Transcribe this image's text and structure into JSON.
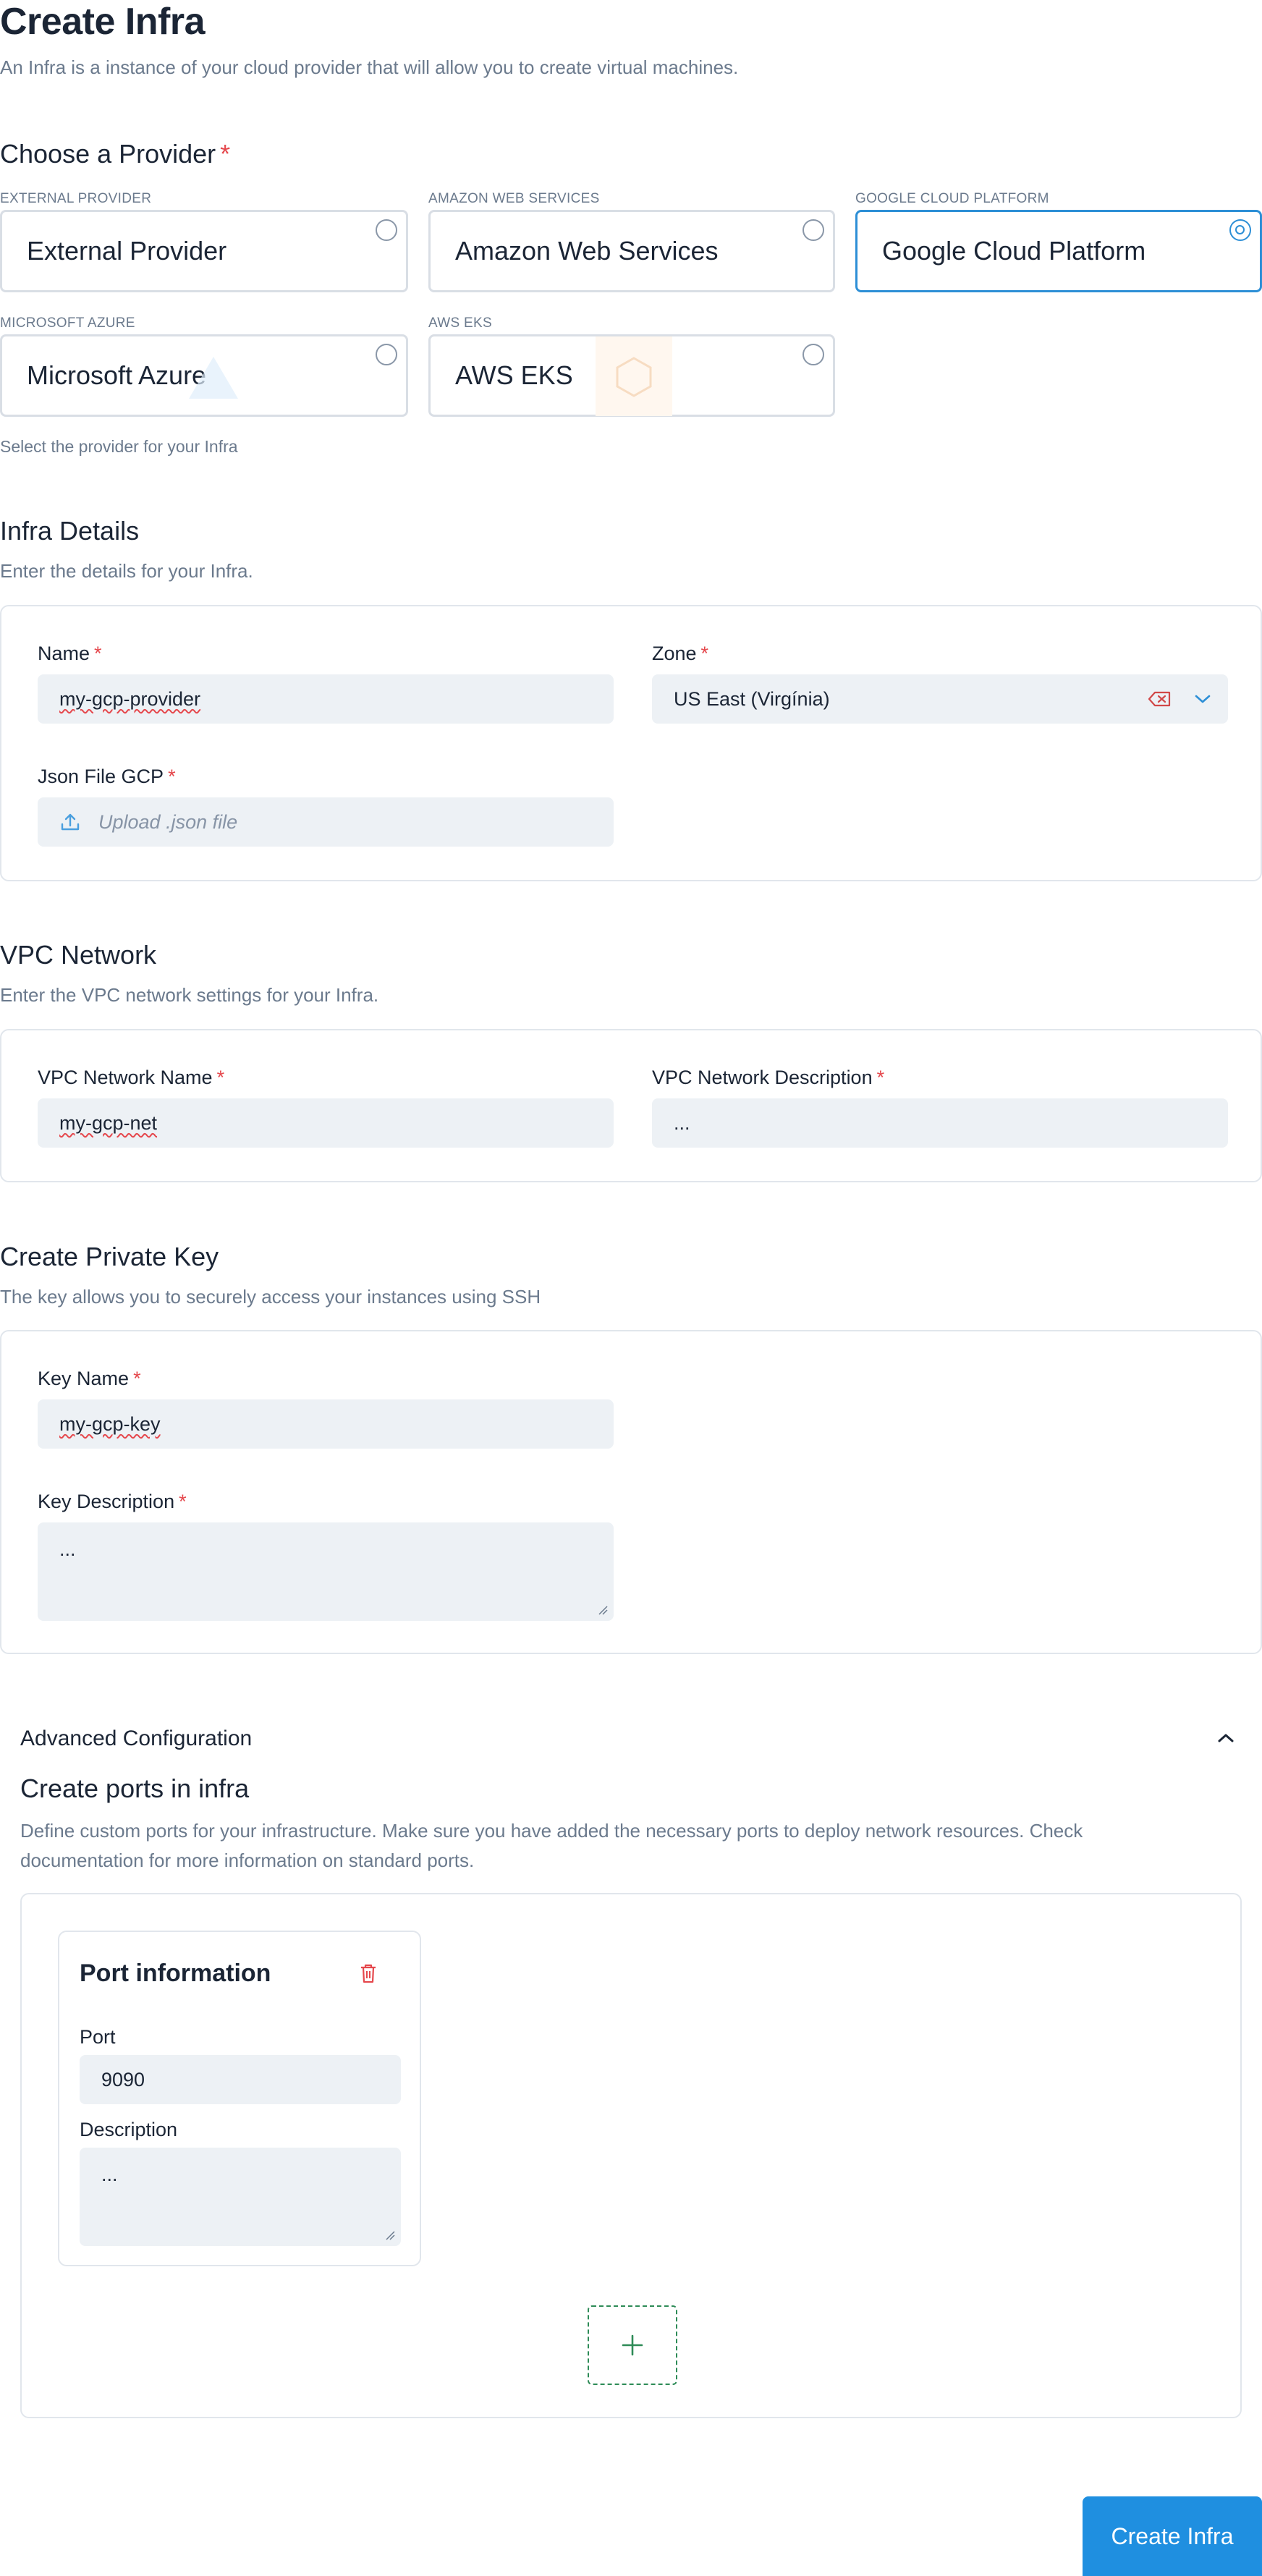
{
  "page": {
    "title": "Create Infra",
    "subtitle": "An Infra is a instance of your cloud provider that will allow you to create virtual machines."
  },
  "provider": {
    "heading": "Choose a Provider",
    "required": "*",
    "helper": "Select the provider for your Infra",
    "options": [
      {
        "caption": "EXTERNAL PROVIDER",
        "label": "External Provider",
        "selected": false
      },
      {
        "caption": "AMAZON WEB SERVICES",
        "label": "Amazon Web Services",
        "selected": false
      },
      {
        "caption": "GOOGLE CLOUD PLATFORM",
        "label": "Google Cloud Platform",
        "selected": true
      },
      {
        "caption": "MICROSOFT AZURE",
        "label": "Microsoft Azure",
        "selected": false
      },
      {
        "caption": "AWS EKS",
        "label": "AWS EKS",
        "selected": false
      }
    ]
  },
  "details": {
    "heading": "Infra Details",
    "subtitle": "Enter the details for your Infra.",
    "name_label": "Name",
    "name_value": "my-gcp-provider",
    "zone_label": "Zone",
    "zone_value": "US East (Virgínia)",
    "json_label": "Json File GCP",
    "json_placeholder": "Upload .json file",
    "required": "*"
  },
  "vpc": {
    "heading": "VPC Network",
    "subtitle": "Enter the VPC network settings for your Infra.",
    "name_label": "VPC Network Name",
    "name_value": "my-gcp-net",
    "desc_label": "VPC Network Description",
    "desc_value": "...",
    "required": "*"
  },
  "key": {
    "heading": "Create Private Key",
    "subtitle": "The key allows you to securely access your instances using SSH",
    "name_label": "Key Name",
    "name_value": "my-gcp-key",
    "desc_label": "Key Description",
    "desc_value": "...",
    "required": "*"
  },
  "advanced": {
    "toggle_label": "Advanced Configuration",
    "ports_heading": "Create ports in infra",
    "ports_description": "Define custom ports for your infrastructure. Make sure you have added the necessary ports to deploy network resources. Check documentation for more information on standard ports.",
    "port_card": {
      "title": "Port information",
      "port_label": "Port",
      "port_value": "9090",
      "desc_label": "Description",
      "desc_value": "..."
    },
    "add_symbol": "+"
  },
  "submit_label": "Create Infra",
  "colors": {
    "accent": "#2d8fd6",
    "required": "#e5484d",
    "add_border": "#2e8b57",
    "submit_bg": "#1f8fe0"
  },
  "icons": [
    "chevron-up-icon",
    "chevron-down-icon",
    "clear-icon",
    "upload-icon",
    "trash-icon",
    "plus-icon"
  ]
}
